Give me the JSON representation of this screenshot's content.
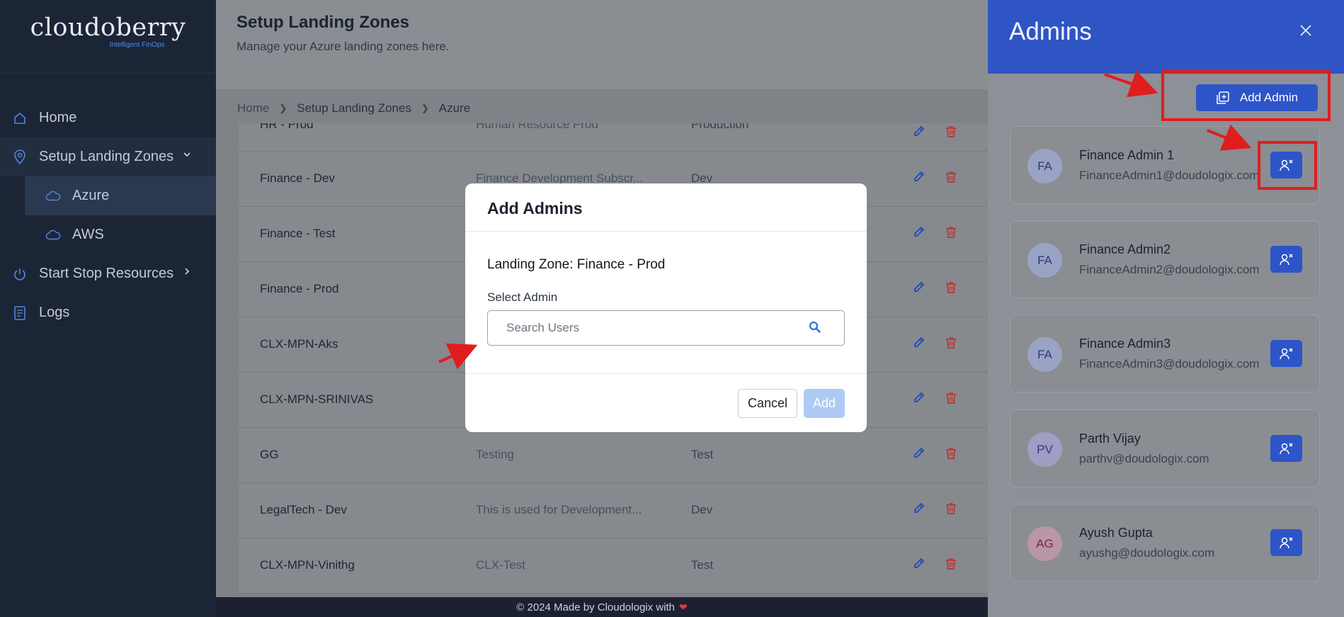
{
  "brand": {
    "name": "cloudoberry",
    "tagline": "Intelligent FinOps"
  },
  "sidebar": {
    "items": [
      {
        "label": "Home",
        "icon": "home-icon"
      },
      {
        "label": "Setup Landing Zones",
        "icon": "location-pin-icon",
        "expanded": true
      },
      {
        "label": "Azure",
        "icon": "cloud-icon",
        "active": true
      },
      {
        "label": "AWS",
        "icon": "cloud-icon"
      },
      {
        "label": "Start Stop Resources",
        "icon": "power-icon"
      },
      {
        "label": "Logs",
        "icon": "logs-icon"
      }
    ]
  },
  "page": {
    "title": "Setup Landing Zones",
    "subtitle": "Manage your Azure landing zones here."
  },
  "breadcrumb": [
    "Home",
    "Setup Landing Zones",
    "Azure"
  ],
  "table": {
    "rows": [
      {
        "name": "HR - Prod",
        "description": "Human Resource Prod",
        "environment": "Production"
      },
      {
        "name": "Finance - Dev",
        "description": "Finance Development Subscr...",
        "environment": "Dev"
      },
      {
        "name": "Finance - Test",
        "description": "",
        "environment": ""
      },
      {
        "name": "Finance - Prod",
        "description": "",
        "environment": ""
      },
      {
        "name": "CLX-MPN-Aks",
        "description": "",
        "environment": ""
      },
      {
        "name": "CLX-MPN-SRINIVAS",
        "description": "",
        "environment": ""
      },
      {
        "name": "GG",
        "description": "Testing",
        "environment": "Test"
      },
      {
        "name": "LegalTech - Dev",
        "description": "This is used for Development...",
        "environment": "Dev"
      },
      {
        "name": "CLX-MPN-Vinithg",
        "description": "CLX-Test",
        "environment": "Test"
      }
    ]
  },
  "footer": {
    "text": "© 2024 Made by Cloudologix with"
  },
  "modal": {
    "title": "Add Admins",
    "landing_zone": "Landing Zone: Finance - Prod",
    "select_label": "Select Admin",
    "search_placeholder": "Search Users",
    "cancel_label": "Cancel",
    "add_label": "Add"
  },
  "panel": {
    "title": "Admins",
    "add_admin_label": "Add Admin",
    "admins": [
      {
        "initials": "FA",
        "name": "Finance Admin 1",
        "email": "FinanceAdmin1@doudologix.com",
        "avatar_bg": "#9aa3c4",
        "avatar_fg": "#2b3a78"
      },
      {
        "initials": "FA",
        "name": "Finance Admin2",
        "email": "FinanceAdmin2@doudologix.com",
        "avatar_bg": "#9aa3c4",
        "avatar_fg": "#2b3a78"
      },
      {
        "initials": "FA",
        "name": "Finance Admin3",
        "email": "FinanceAdmin3@doudologix.com",
        "avatar_bg": "#9aa3c4",
        "avatar_fg": "#2b3a78"
      },
      {
        "initials": "PV",
        "name": "Parth Vijay",
        "email": "parthv@doudologix.com",
        "avatar_bg": "#9f9ec4",
        "avatar_fg": "#3b3386"
      },
      {
        "initials": "AG",
        "name": "Ayush Gupta",
        "email": "ayushg@doudologix.com",
        "avatar_bg": "#b996a8",
        "avatar_fg": "#7a2449"
      }
    ]
  },
  "colors": {
    "accent": "#2d55c8",
    "annotation": "#e11d1d",
    "sidebar": "#1c2536",
    "delete": "#c0322c"
  }
}
